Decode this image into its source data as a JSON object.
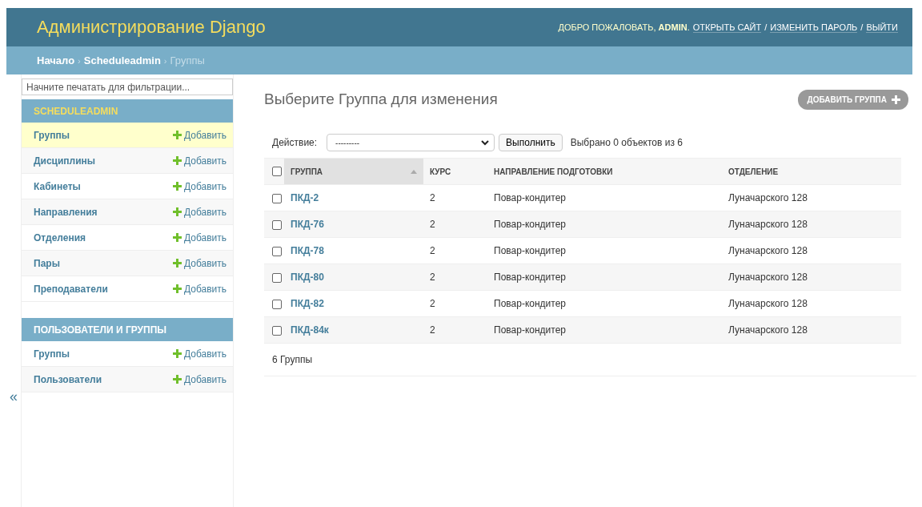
{
  "header": {
    "title": "Администрирование Django",
    "welcome": "ДОБРО ПОЖАЛОВАТЬ,",
    "user": "ADMIN",
    "user_end": ".",
    "link_separator": "/",
    "links": [
      "ОТКРЫТЬ САЙТ",
      "ИЗМЕНИТЬ ПАРОЛЬ",
      "ВЫЙТИ"
    ]
  },
  "breadcrumbs": {
    "links": [
      "Начало",
      "Scheduleadmin"
    ],
    "current": "Группы",
    "separator": "›"
  },
  "sidebar": {
    "filter": {
      "placeholder": "Начните печатать для фильтрации..."
    },
    "collapse": "«",
    "modules": [
      {
        "caption": "SCHEDULEADMIN",
        "current": true,
        "items": [
          {
            "label": "Группы",
            "add": "Добавить",
            "selected": true
          },
          {
            "label": "Дисциплины",
            "add": "Добавить",
            "selected": false
          },
          {
            "label": "Кабинеты",
            "add": "Добавить",
            "selected": false
          },
          {
            "label": "Направления",
            "add": "Добавить",
            "selected": false
          },
          {
            "label": "Отделения",
            "add": "Добавить",
            "selected": false
          },
          {
            "label": "Пары",
            "add": "Добавить",
            "selected": false
          },
          {
            "label": "Преподаватели",
            "add": "Добавить",
            "selected": false
          }
        ]
      },
      {
        "caption": "ПОЛЬЗОВАТЕЛИ И ГРУППЫ",
        "current": false,
        "items": [
          {
            "label": "Группы",
            "add": "Добавить",
            "selected": false
          },
          {
            "label": "Пользователи",
            "add": "Добавить",
            "selected": false
          }
        ]
      }
    ]
  },
  "content": {
    "title": "Выберите Группа для изменения",
    "add_button": "ДОБАВИТЬ ГРУППА",
    "actions": {
      "label": "Действие:",
      "value": "---------",
      "run": "Выполнить",
      "counter": "Выбрано 0 объектов из 6"
    },
    "table": {
      "select_all": false,
      "columns": [
        {
          "label": "ГРУППА",
          "sorted": true
        },
        {
          "label": "КУРС",
          "sorted": false
        },
        {
          "label": "НАПРАВЛЕНИЕ ПОДГОТОВКИ",
          "sorted": false
        },
        {
          "label": "ОТДЕЛЕНИЕ",
          "sorted": false
        }
      ],
      "rows": [
        {
          "checked": false,
          "cells": [
            "ПКД-2",
            "2",
            "Повар-кондитер",
            "Луначарского 128"
          ]
        },
        {
          "checked": false,
          "cells": [
            "ПКД-76",
            "2",
            "Повар-кондитер",
            "Луначарского 128"
          ]
        },
        {
          "checked": false,
          "cells": [
            "ПКД-78",
            "2",
            "Повар-кондитер",
            "Луначарского 128"
          ]
        },
        {
          "checked": false,
          "cells": [
            "ПКД-80",
            "2",
            "Повар-кондитер",
            "Луначарского 128"
          ]
        },
        {
          "checked": false,
          "cells": [
            "ПКД-82",
            "2",
            "Повар-кондитер",
            "Луначарского 128"
          ]
        },
        {
          "checked": false,
          "cells": [
            "ПКД-84к",
            "2",
            "Повар-кондитер",
            "Луначарского 128"
          ]
        }
      ]
    },
    "paginator": "6 Группы"
  }
}
